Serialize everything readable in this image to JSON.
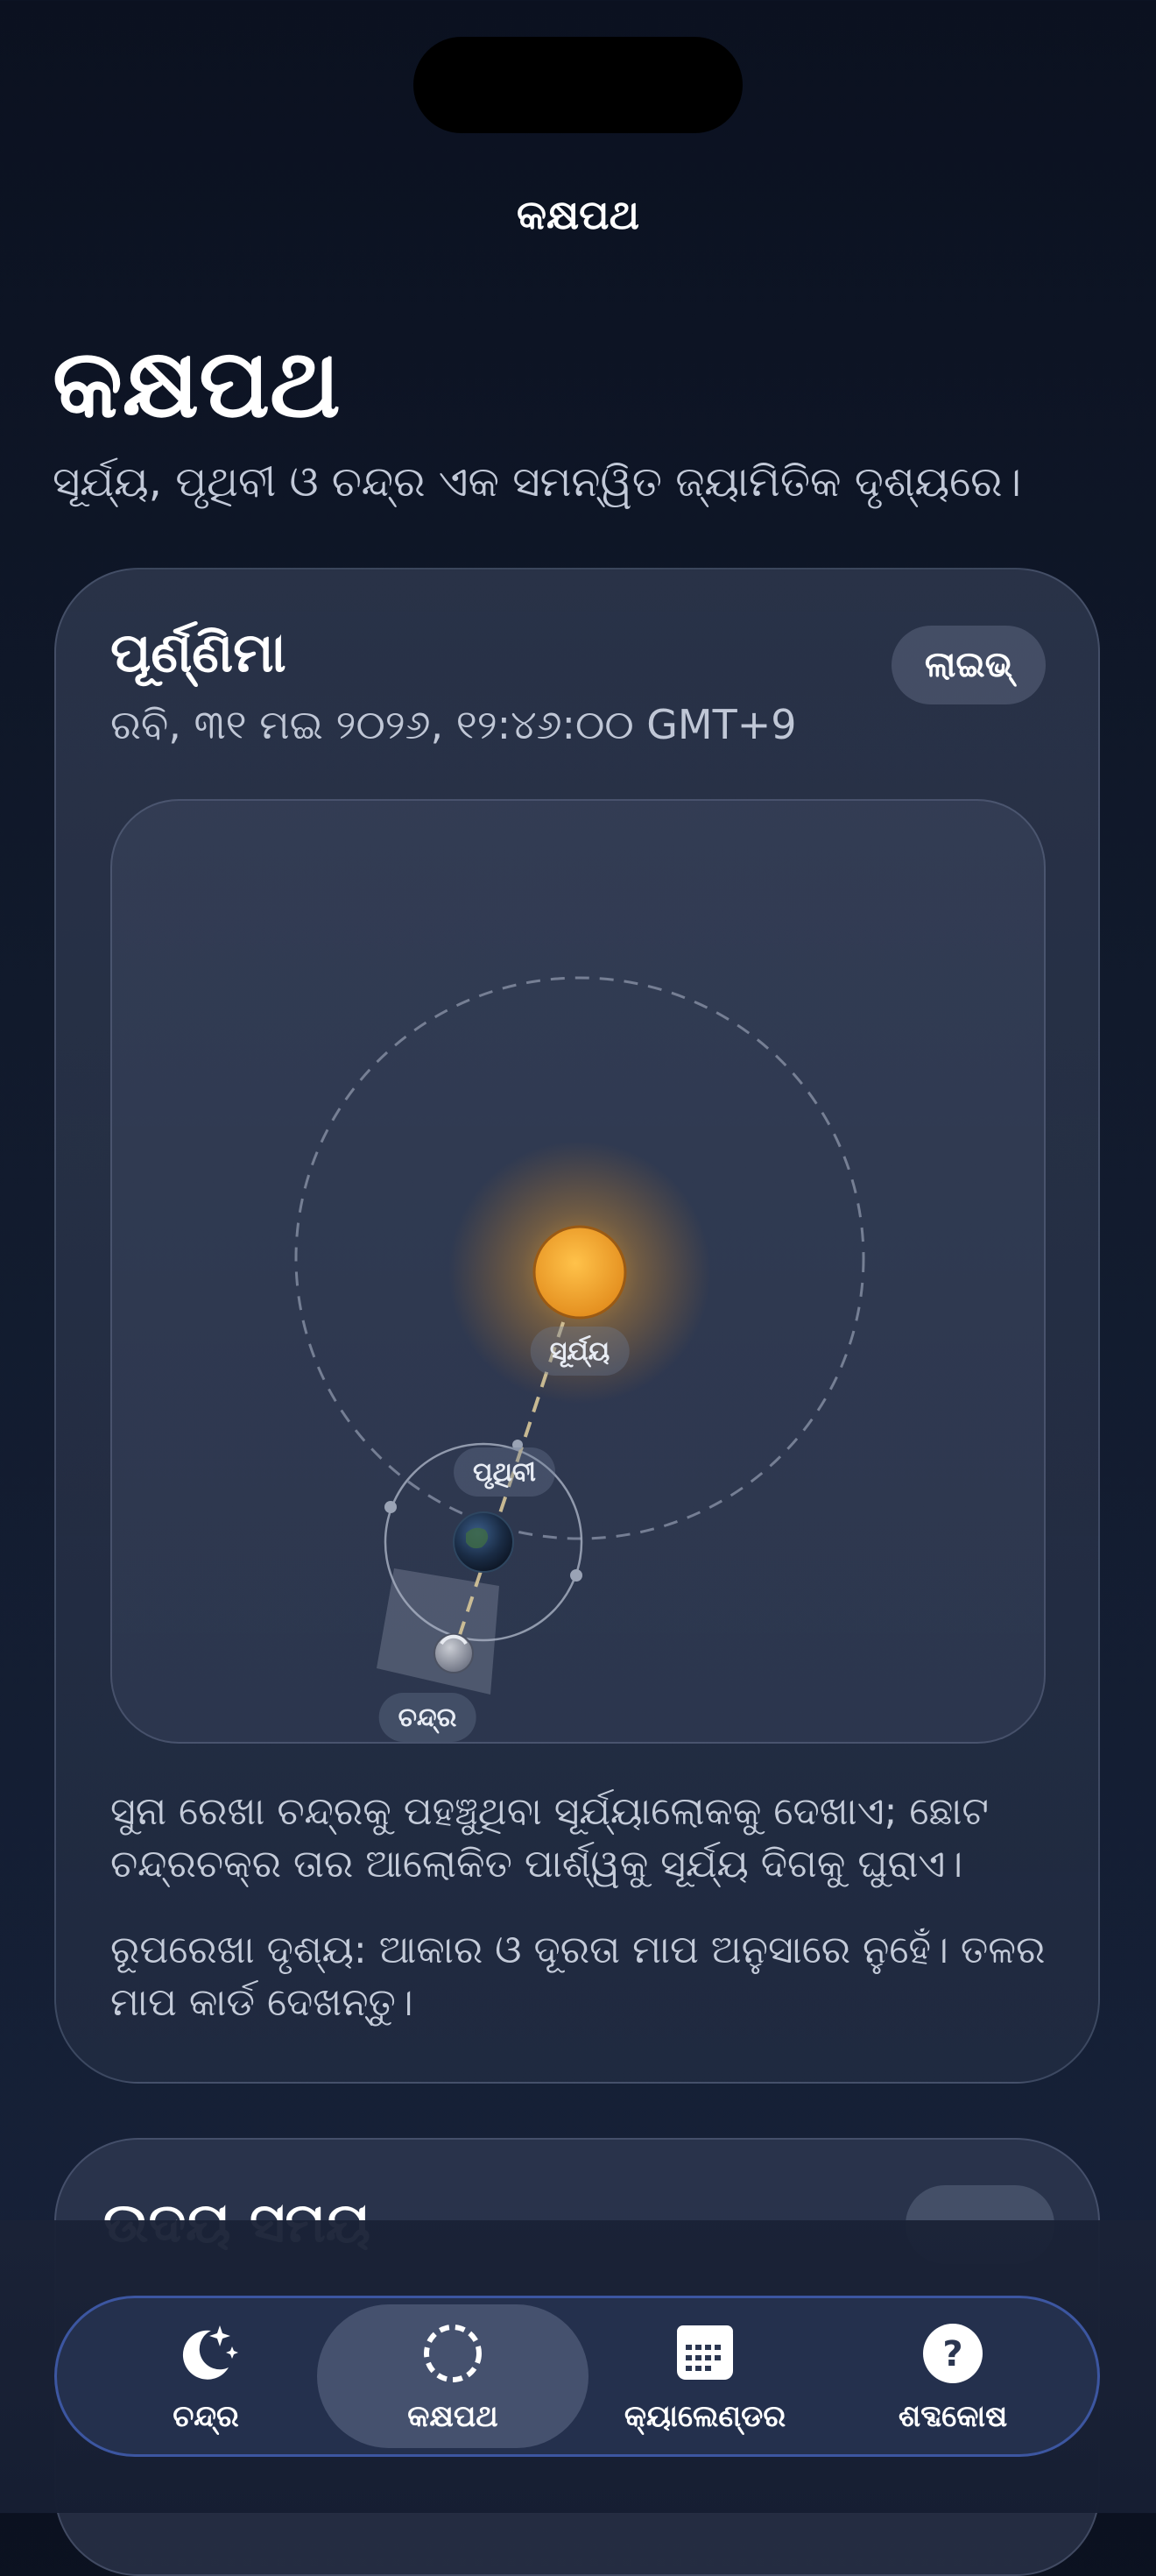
{
  "header": {
    "nav_title": "କକ୍ଷପଥ",
    "title": "କକ୍ଷପଥ",
    "subtitle": "ସୂର୍ଯ୍ୟ, ପୃଥିବୀ ଓ ଚନ୍ଦ୍ର ଏକ ସମନ୍ୱିତ ଜ୍ୟାମିତିକ ଦୃଶ୍ୟରେ।"
  },
  "orbit_card": {
    "phase_name": "ପୂର୍ଣ୍ଣିମା",
    "live_badge": "ଲାଇଭ୍",
    "datetime": "ରବି, ୩୧ ମଇ ୨୦୨୬, ୧୨:୪୬:୦୦ GMT+9",
    "labels": {
      "sun": "ସୂର୍ଯ୍ୟ",
      "earth": "ପୃଥିବୀ",
      "moon": "ଚନ୍ଦ୍ର"
    },
    "colors": {
      "sun": "#f2a531",
      "sunlight_line": "#d8c79a",
      "orbit": "#8d97ab"
    },
    "description": "ସୁନା ରେଖା ଚନ୍ଦ୍ରକୁ ପହଞ୍ଚୁଥିବା ସୂର୍ଯ୍ୟାଲୋକକୁ ଦେଖାଏ; ଛୋଟ ଚନ୍ଦ୍ରଚକ୍ର ତାର ଆଲୋକିତ ପାର୍ଶ୍ୱକୁ ସୂର୍ଯ୍ୟ ଦିଗକୁ ଘୁରାଏ।",
    "note": "ରୂପରେଖା ଦୃଶ୍ୟ: ଆକାର ଓ ଦୂରତା ମାପ ଅନୁସାରେ ନୁହେଁ। ତଳର ମାପ କାର୍ଡ ଦେଖନ୍ତୁ।"
  },
  "next_card": {
    "title": "ଉଦୟ ସମୟ"
  },
  "tabbar": {
    "tabs": [
      {
        "label": "ଚନ୍ଦ୍ର",
        "icon": "moon-stars-icon",
        "active": false
      },
      {
        "label": "କକ୍ଷପଥ",
        "icon": "orbit-icon",
        "active": true
      },
      {
        "label": "କ୍ୟାଲେଣ୍ଡର",
        "icon": "calendar-icon",
        "active": false
      },
      {
        "label": "ଶବ୍ଦକୋଷ",
        "icon": "question-icon",
        "active": false
      }
    ]
  }
}
